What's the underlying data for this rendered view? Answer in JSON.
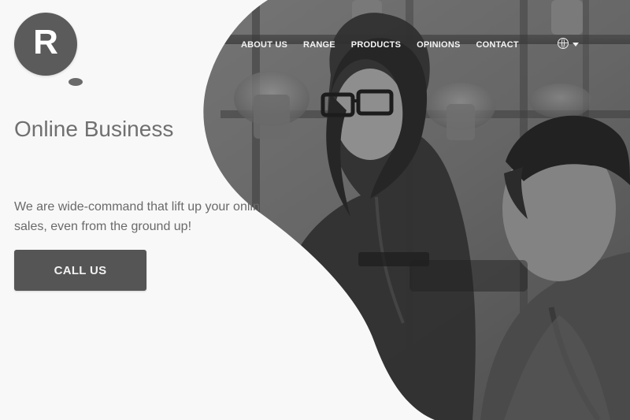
{
  "logo": {
    "letter": "R"
  },
  "nav": {
    "items": [
      {
        "label": "ABOUT US"
      },
      {
        "label": "RANGE"
      },
      {
        "label": "PRODUCTS"
      },
      {
        "label": "OPINIONS"
      },
      {
        "label": "CONTACT"
      }
    ],
    "language_icon": "globe-icon"
  },
  "hero": {
    "title": "Online Business",
    "tagline": "We are wide-command that lift up your online sales, even from the ground up!",
    "cta_label": "CALL US"
  },
  "colors": {
    "panel_bg": "#f8f8f8",
    "text_primary": "#707070",
    "text_secondary": "#6a6a6a",
    "button_bg": "#555555",
    "button_text": "#f1f1f1",
    "nav_text": "#f5f5f5"
  }
}
